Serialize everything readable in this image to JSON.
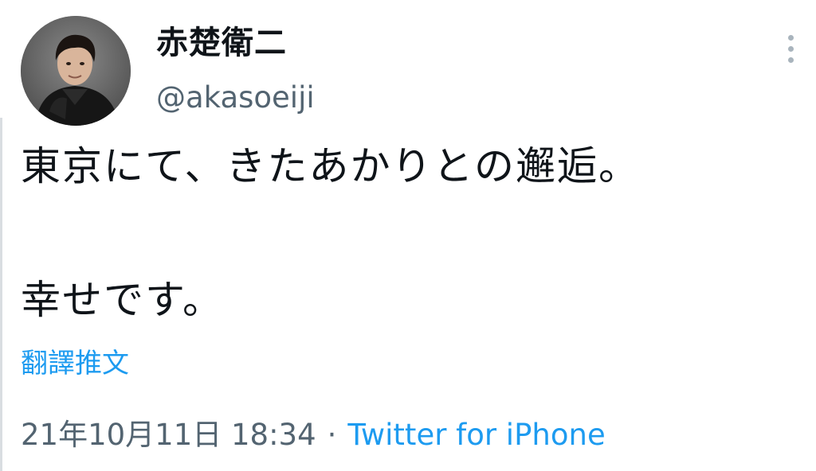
{
  "user": {
    "display_name": "赤楚衛二",
    "handle": "@akasoeiji"
  },
  "tweet": {
    "line1": "東京にて、きたあかりとの邂逅。",
    "line2": "幸せです。",
    "translate_label": "翻譯推文",
    "timestamp": "21年10月11日 18:34",
    "separator": "·",
    "source": "Twitter for iPhone"
  },
  "icons": {
    "more": "more-vertical-icon"
  },
  "colors": {
    "text": "#0f1419",
    "secondary": "#536471",
    "link": "#1d9bf0"
  }
}
